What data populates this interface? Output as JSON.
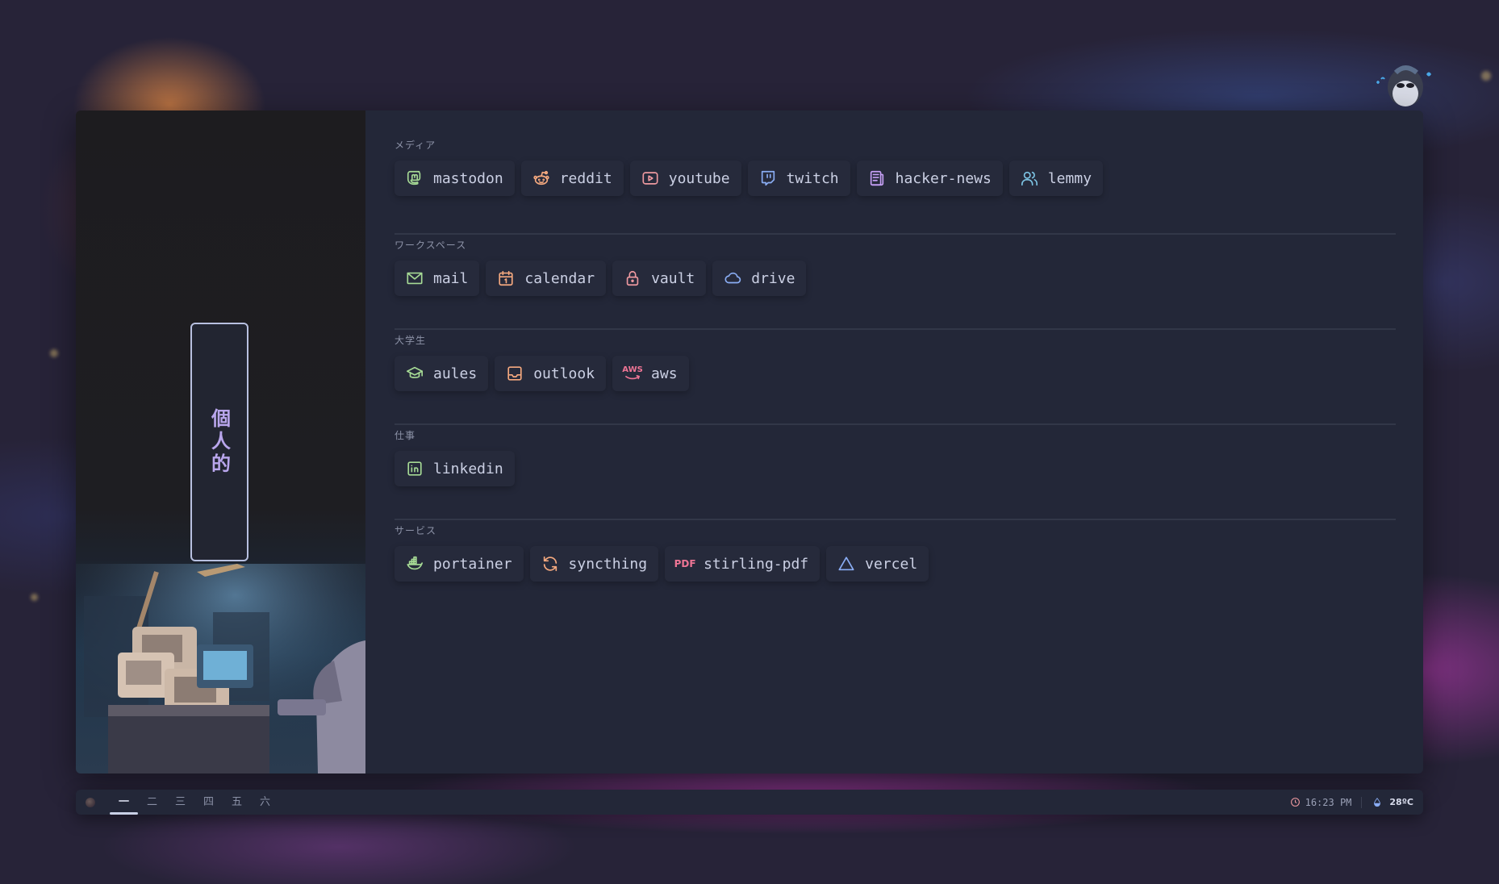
{
  "sidebar": {
    "vertical_label": "個人的"
  },
  "sections": [
    {
      "title": "メディア",
      "links": [
        {
          "label": "mastodon",
          "icon": "mastodon-icon",
          "color": "#a6da95"
        },
        {
          "label": "reddit",
          "icon": "reddit-icon",
          "color": "#f5a97f"
        },
        {
          "label": "youtube",
          "icon": "youtube-icon",
          "color": "#ee99a0"
        },
        {
          "label": "twitch",
          "icon": "twitch-icon",
          "color": "#8aadf4"
        },
        {
          "label": "hacker-news",
          "icon": "news-icon",
          "color": "#c6a0f6"
        },
        {
          "label": "lemmy",
          "icon": "users-icon",
          "color": "#7dc4e4"
        }
      ]
    },
    {
      "title": "ワークスペース",
      "links": [
        {
          "label": "mail",
          "icon": "mail-icon",
          "color": "#a6da95"
        },
        {
          "label": "calendar",
          "icon": "calendar-icon",
          "color": "#f5a97f"
        },
        {
          "label": "vault",
          "icon": "lock-icon",
          "color": "#ee99a0"
        },
        {
          "label": "drive",
          "icon": "cloud-icon",
          "color": "#8aadf4"
        }
      ]
    },
    {
      "title": "大学生",
      "links": [
        {
          "label": "aules",
          "icon": "graduation-cap-icon",
          "color": "#a6da95"
        },
        {
          "label": "outlook",
          "icon": "inbox-icon",
          "color": "#f5a97f"
        },
        {
          "label": "aws",
          "icon": "aws-icon",
          "color": "#ee99a0",
          "icon_text": "AWS"
        }
      ]
    },
    {
      "title": "仕事",
      "links": [
        {
          "label": "linkedin",
          "icon": "linkedin-icon",
          "color": "#a6da95"
        }
      ]
    },
    {
      "title": "サービス",
      "links": [
        {
          "label": "portainer",
          "icon": "docker-icon",
          "color": "#a6da95"
        },
        {
          "label": "syncthing",
          "icon": "sync-icon",
          "color": "#f5a97f"
        },
        {
          "label": "stirling-pdf",
          "icon": "pdf-icon",
          "color": "#ee99a0",
          "icon_text": "PDF"
        },
        {
          "label": "vercel",
          "icon": "triangle-icon",
          "color": "#8aadf4"
        }
      ]
    }
  ],
  "taskbar": {
    "workspaces": [
      "一",
      "二",
      "三",
      "四",
      "五",
      "六"
    ],
    "active_workspace": 0,
    "clock": "16:23 PM",
    "temperature": "28ºC"
  }
}
